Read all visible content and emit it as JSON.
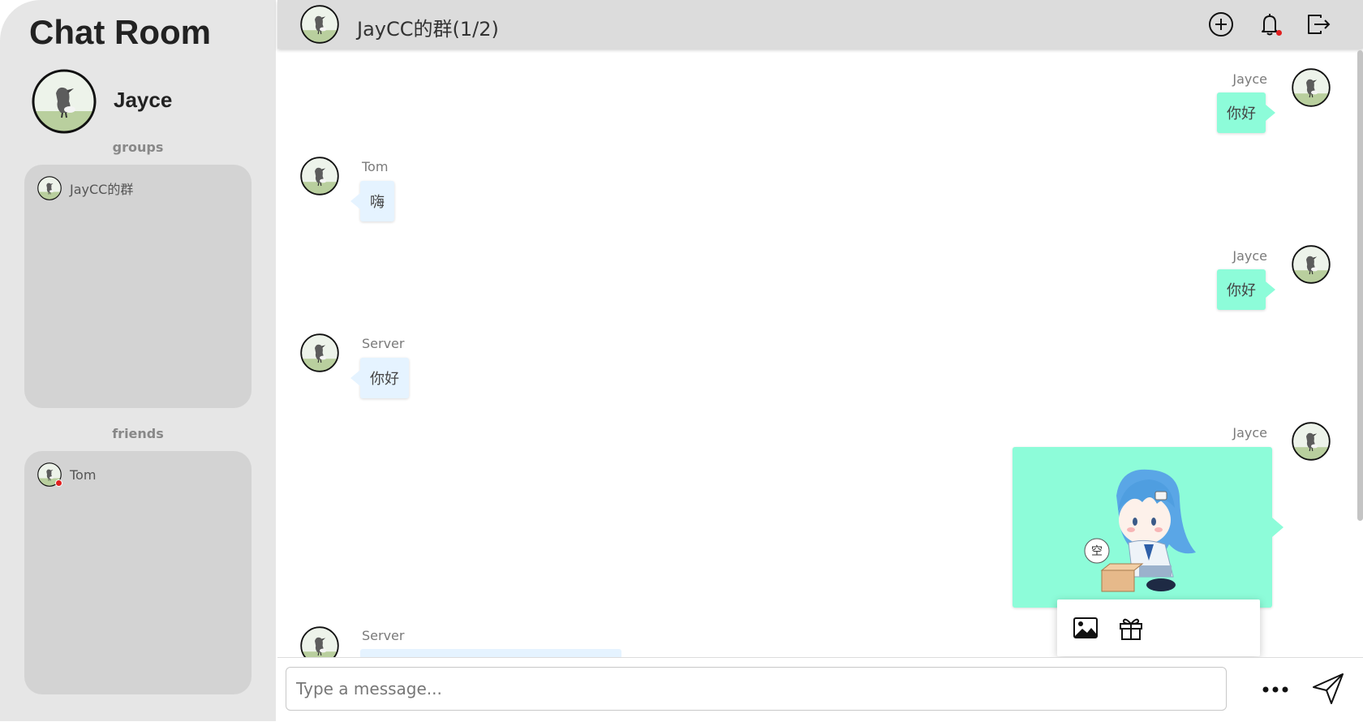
{
  "app": {
    "title": "Chat Room"
  },
  "user": {
    "name": "Jayce",
    "avatar_icon": "bird-avatar-icon"
  },
  "sidebar": {
    "groups_label": "groups",
    "groups": [
      {
        "name": "JayCC的群"
      }
    ],
    "friends_label": "friends",
    "friends": [
      {
        "name": "Tom",
        "unread": true
      }
    ]
  },
  "header": {
    "title": "JayCC的群(1/2)",
    "icons": [
      "add-circle-icon",
      "bell-icon",
      "logout-icon"
    ],
    "notification_dot": true
  },
  "messages": [
    {
      "sender": "Jayce",
      "text": "你好",
      "side": "right"
    },
    {
      "sender": "Tom",
      "text": "嗨",
      "side": "left"
    },
    {
      "sender": "Jayce",
      "text": "你好",
      "side": "right"
    },
    {
      "sender": "Server",
      "text": "你好",
      "side": "left"
    },
    {
      "sender": "Jayce",
      "type": "sticker",
      "sticker_text": "空",
      "side": "right"
    },
    {
      "sender": "Server",
      "text": "",
      "side": "left",
      "partial": true
    }
  ],
  "attach_popup": {
    "icons": [
      "image-icon",
      "gift-icon"
    ]
  },
  "input": {
    "placeholder": "Type a message...",
    "value": ""
  },
  "colors": {
    "sidebar_bg": "#e6e6e6",
    "list_bg": "#d3d3d3",
    "header_bg": "#dcdcdc",
    "bubble_own": "#8dfcd9",
    "bubble_other": "#e5f3ff",
    "unread_dot": "#e02020"
  }
}
